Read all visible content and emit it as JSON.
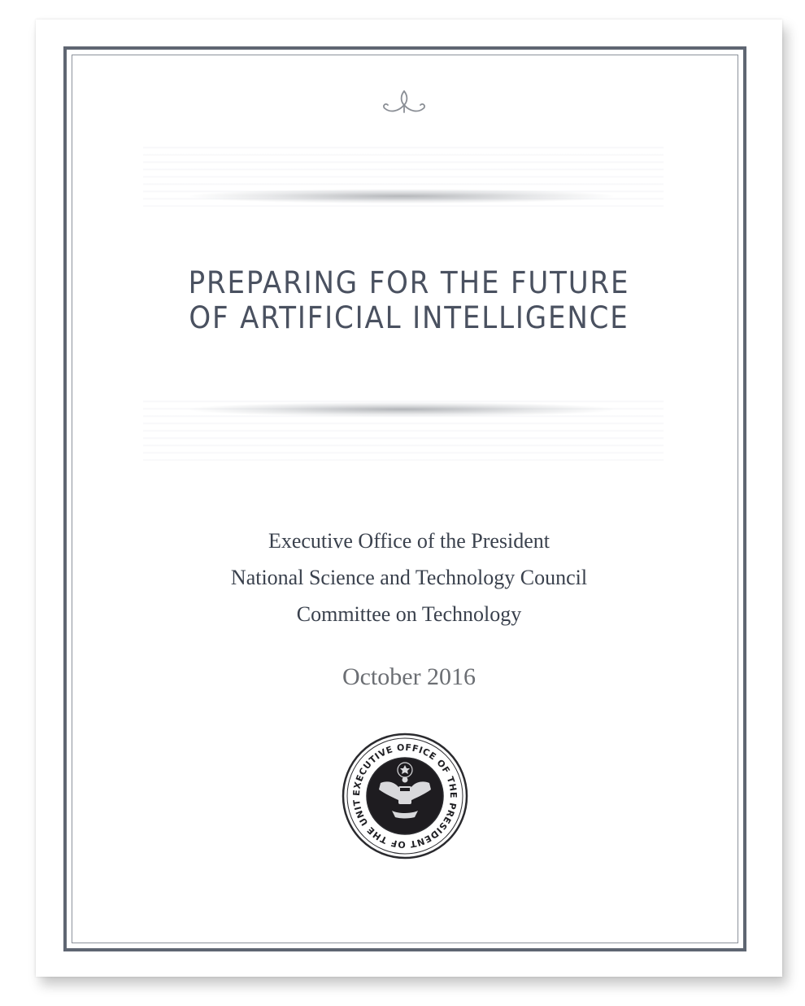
{
  "cover": {
    "title_line1": "PREPARING FOR THE FUTURE",
    "title_line2": "OF ARTIFICIAL INTELLIGENCE",
    "organizations": [
      "Executive Office of the President",
      "National Science and Technology Council",
      "Committee on Technology"
    ],
    "date": "October 2016",
    "seal_text": "EXECUTIVE OFFICE OF THE PRESIDENT OF THE UNITED STATES"
  },
  "icons": {
    "ornament": "flourish-ornament-icon",
    "seal": "presidential-seal-icon"
  },
  "colors": {
    "title": "#4a5160",
    "body_text": "#3a414d",
    "date": "#6b6e73",
    "border": "#5f6672"
  }
}
